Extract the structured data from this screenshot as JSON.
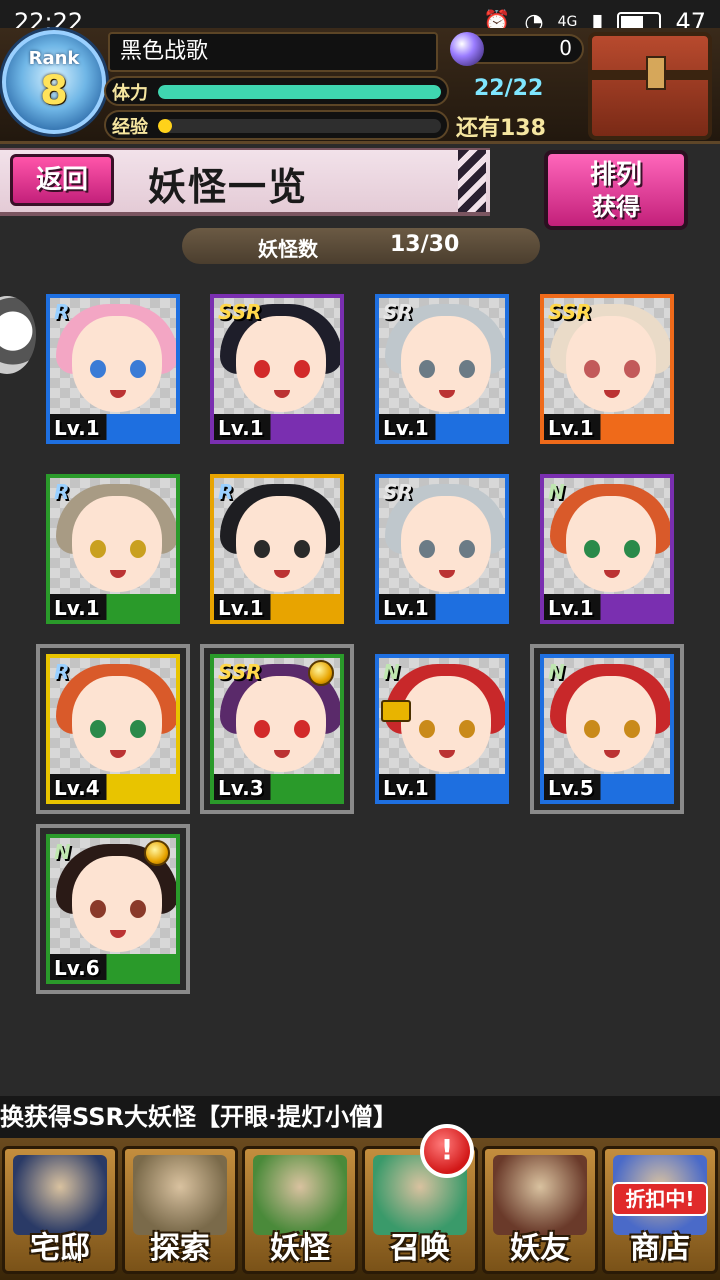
{
  "status_bar": {
    "time": "22:22",
    "network": "4G",
    "battery": "47"
  },
  "player": {
    "rank_label": "Rank",
    "rank": "8",
    "name": "黑色战歌",
    "orbs": "0",
    "stamina_label": "体力",
    "stamina_value": "22/22",
    "stamina_fraction": 1.0,
    "exp_label": "经验",
    "exp_remaining": "还有138",
    "exp_fraction": 0.05
  },
  "nav": {
    "back_label": "返回",
    "title": "妖怪一览",
    "sort_line1": "排列",
    "sort_line2": "获得"
  },
  "count": {
    "label": "妖怪数",
    "value": "13/30"
  },
  "colors": {
    "R": "#1e6fe0",
    "SSR": "#7a2fb0",
    "SR": "#1e6fe0",
    "N": "#2a9a2a",
    "stamina": "#3fd6b0",
    "exp": "#ffd21a"
  },
  "cards": [
    {
      "rarity": "R",
      "level": "Lv.1",
      "border": "#1e6fe0",
      "bar": "#1e6fe0",
      "hair": "#f3a6c4",
      "eyes": "#3a7bd6",
      "framed": false,
      "medal": false,
      "lock": false
    },
    {
      "rarity": "SSR",
      "level": "Lv.1",
      "border": "#7a2fb0",
      "bar": "#7a2fb0",
      "hair": "#1e1e2a",
      "eyes": "#d22a2a",
      "framed": false,
      "medal": false,
      "lock": false
    },
    {
      "rarity": "SR",
      "level": "Lv.1",
      "border": "#1e6fe0",
      "bar": "#1e6fe0",
      "hair": "#bfc7cc",
      "eyes": "#6b7b86",
      "framed": false,
      "medal": false,
      "lock": false
    },
    {
      "rarity": "SSR",
      "level": "Lv.1",
      "border": "#ef6a1a",
      "bar": "#ef6a1a",
      "hair": "#eadbc8",
      "eyes": "#c25a5a",
      "framed": false,
      "medal": false,
      "lock": false
    },
    {
      "rarity": "R",
      "level": "Lv.1",
      "border": "#2a9a2a",
      "bar": "#2a9a2a",
      "hair": "#a89b84",
      "eyes": "#c9a020",
      "framed": false,
      "medal": false,
      "lock": false
    },
    {
      "rarity": "R",
      "level": "Lv.1",
      "border": "#e8a400",
      "bar": "#e8a400",
      "hair": "#1e1e22",
      "eyes": "#2a2a2a",
      "framed": false,
      "medal": false,
      "lock": false
    },
    {
      "rarity": "SR",
      "level": "Lv.1",
      "border": "#1e6fe0",
      "bar": "#1e6fe0",
      "hair": "#bfc7cc",
      "eyes": "#6b7b86",
      "framed": false,
      "medal": false,
      "lock": false
    },
    {
      "rarity": "N",
      "level": "Lv.1",
      "border": "#7a2fb0",
      "bar": "#7a2fb0",
      "hair": "#d95a2a",
      "eyes": "#2a8a4a",
      "framed": false,
      "medal": false,
      "lock": false
    },
    {
      "rarity": "R",
      "level": "Lv.4",
      "border": "#e8c400",
      "bar": "#e8c400",
      "hair": "#d95a2a",
      "eyes": "#2a8a4a",
      "framed": true,
      "medal": false,
      "lock": false
    },
    {
      "rarity": "SSR",
      "level": "Lv.3",
      "border": "#2a9a2a",
      "bar": "#2a9a2a",
      "hair": "#5a2a6a",
      "eyes": "#d22a2a",
      "framed": true,
      "medal": true,
      "lock": false
    },
    {
      "rarity": "N",
      "level": "Lv.1",
      "border": "#1e6fe0",
      "bar": "#1e6fe0",
      "hair": "#c8282a",
      "eyes": "#c98a1a",
      "framed": false,
      "medal": false,
      "lock": true
    },
    {
      "rarity": "N",
      "level": "Lv.5",
      "border": "#1e6fe0",
      "bar": "#1e6fe0",
      "hair": "#c8282a",
      "eyes": "#c98a1a",
      "framed": true,
      "medal": false,
      "lock": false
    },
    {
      "rarity": "N",
      "level": "Lv.6",
      "border": "#2a9a2a",
      "bar": "#2a9a2a",
      "hair": "#2a1a16",
      "eyes": "#8a3a2a",
      "framed": true,
      "medal": true,
      "lock": false
    }
  ],
  "ticker": "换获得SSR大妖怪【开眼·提灯小僧】",
  "bottom_nav": [
    {
      "label": "宅邸",
      "icon": "mansion-icon"
    },
    {
      "label": "探索",
      "icon": "magnifier-map-icon"
    },
    {
      "label": "妖怪",
      "icon": "scroll-icon"
    },
    {
      "label": "召唤",
      "icon": "pentagram-icon",
      "badge": "!"
    },
    {
      "label": "妖友",
      "icon": "catgirl-icon"
    },
    {
      "label": "商店",
      "icon": "shop-orb-icon",
      "tag": "折扣中!"
    }
  ]
}
